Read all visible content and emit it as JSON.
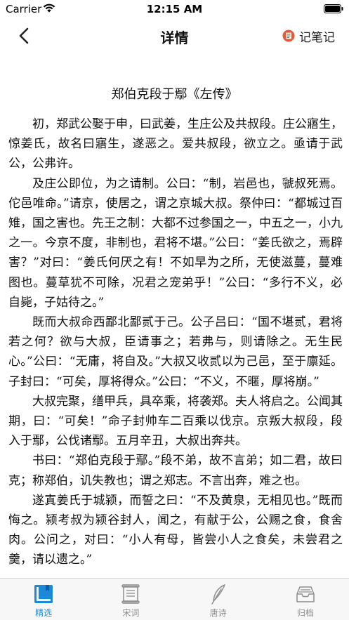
{
  "status_bar": {
    "carrier": "Carrier",
    "time": "12:15 AM"
  },
  "nav": {
    "title": "详情",
    "notes_label": "记笔记"
  },
  "article": {
    "title": "郑伯克段于鄢《左传》",
    "paragraphs": [
      "初，郑武公娶于申，曰武姜，生庄公及共叔段。庄公寤生，惊姜氏，故名曰寤生，遂恶之。爱共叔段，欲立之。亟请于武公，公弗许。",
      "及庄公即位，为之请制。公曰：“制，岩邑也，虢叔死焉。佗邑唯命。”请京，使居之，谓之京城大叔。祭仲曰：“都城过百雉，国之害也。先王之制：大都不过参国之一，中五之一，小九之一。今京不度，非制也，君将不堪。”公曰：“姜氏欲之，焉辟害？”对曰：“姜氏何厌之有！不如早为之所，无使滋蔓，蔓难图也。蔓草犹不可除，况君之宠弟乎！”公曰：“多行不义，必自毙，子姑待之。”",
      "既而大叔命西鄙北鄙贰于己。公子吕曰：“国不堪贰，君将若之何？欲与大叔，臣请事之；若弗与，则请除之。无生民心。”公曰：“无庸，将自及。”大叔又收贰以为己邑，至于廪延。子封曰：“可矣，厚将得众。”公曰：“不义，不暱，厚将崩。”",
      "大叔完聚，缮甲兵，具卒乘，将袭郑。夫人将启之。公闻其期，曰：“可矣！”命子封帅车二百乘以伐京。京叛大叔段，段入于鄢，公伐诸鄢。五月辛丑，大叔出奔共。",
      "书曰：“郑伯克段于鄢。”段不弟，故不言弟；如二君，故曰克；称郑伯，讥失教也；谓之郑志。不言出奔，难之也。",
      "遂寘姜氏于城颍，而誓之曰：“不及黄泉，无相见也。”既而悔之。颍考叔为颍谷封人，闻之，有献于公，公赐之食，食舍肉。公问之，对曰：“小人有母，皆尝小人之食矣，未尝君之羹，请以遗之。”"
    ]
  },
  "tabs": [
    {
      "label": "精选",
      "icon": "book-icon",
      "active": true
    },
    {
      "label": "宋词",
      "icon": "scroll-icon",
      "active": false
    },
    {
      "label": "唐诗",
      "icon": "feather-icon",
      "active": false
    },
    {
      "label": "归档",
      "icon": "archive-tray-icon",
      "active": false
    }
  ],
  "colors": {
    "accent": "#1a8ad8",
    "inactive": "#8e8e8e",
    "notes_icon": "#e25a3a"
  }
}
